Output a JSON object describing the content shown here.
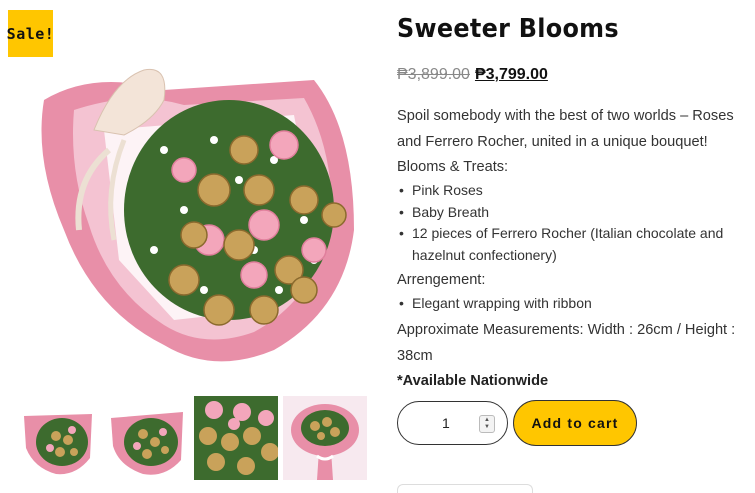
{
  "product": {
    "sale_badge": "Sale!",
    "title": "Sweeter Blooms",
    "old_price": "₱3,899.00",
    "new_price": "₱3,799.00",
    "intro": "Spoil somebody with the best of two worlds – Roses and Ferrero Rocher, united in a unique bouquet!",
    "blooms_heading": "Blooms & Treats:",
    "blooms_items": [
      "Pink Roses",
      "Baby Breath",
      "12 pieces of Ferrero Rocher (Italian chocolate and hazelnut confectionery)"
    ],
    "arrangement_heading": "Arrengement:",
    "arrangement_items": [
      "Elegant wrapping with ribbon"
    ],
    "measurements": "Approximate Measurements: Width : 26cm / Height : 38cm",
    "availability": "*Available Nationwide"
  },
  "cart": {
    "quantity": "1",
    "add_label": "Add to cart"
  },
  "colors": {
    "accent": "#ffc600",
    "wrap_pink": "#e88fa8",
    "rose": "#f3a6bb",
    "gold": "#c9a25a",
    "leaf": "#3d6b2e"
  }
}
